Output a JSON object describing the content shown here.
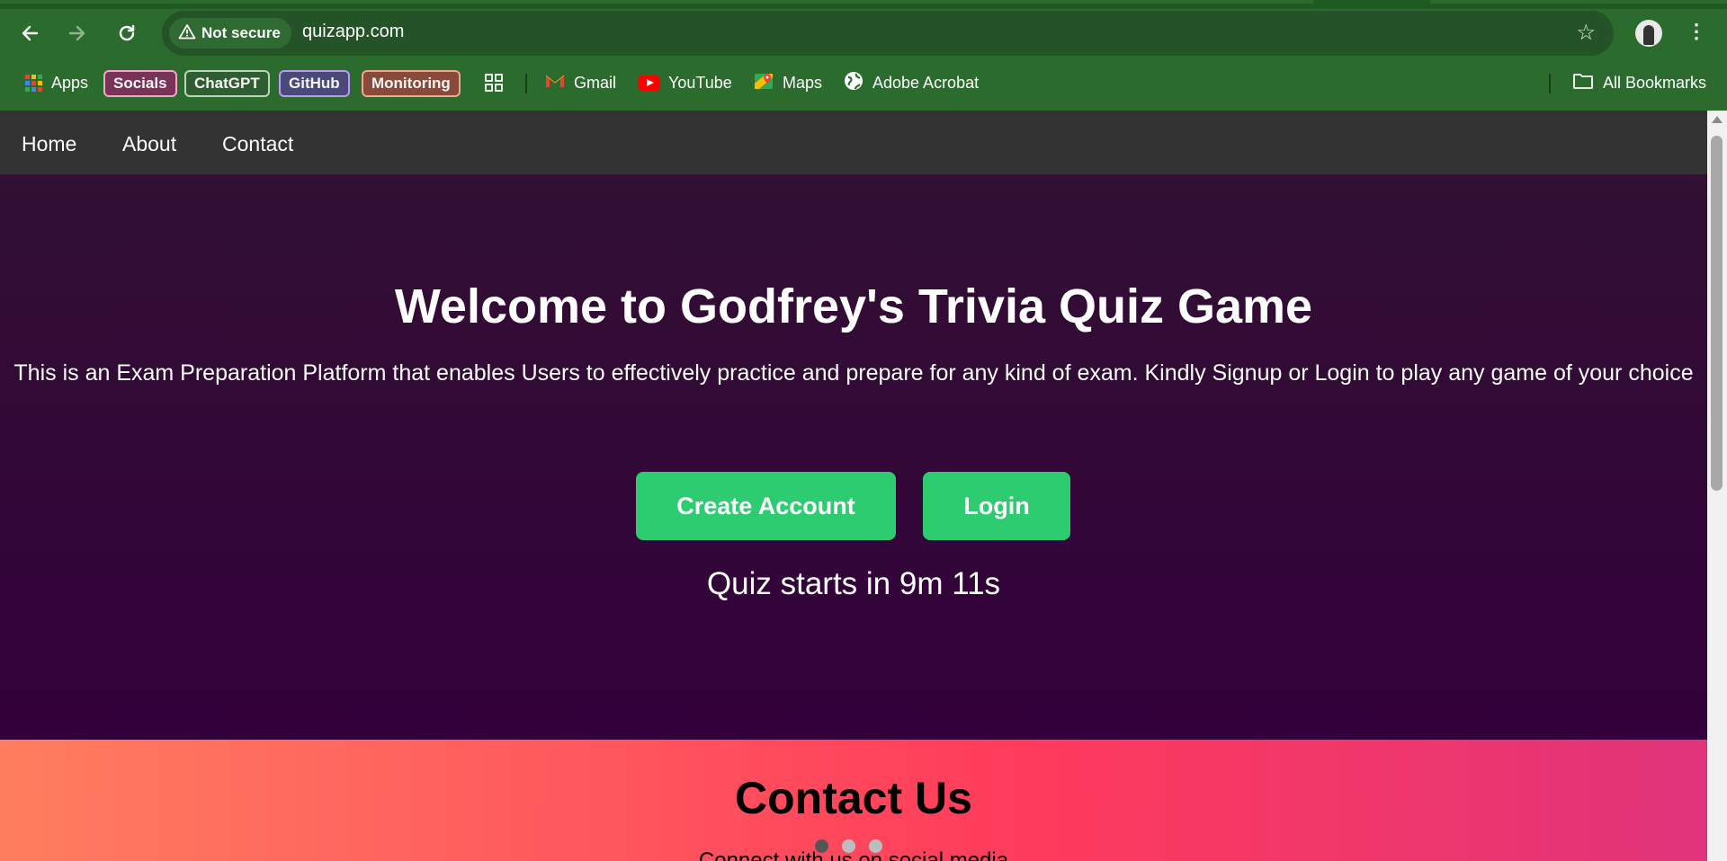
{
  "browser": {
    "security_label": "Not secure",
    "url": "quizapp.com",
    "bookmarks": {
      "apps": "Apps",
      "socials": "Socials",
      "chatgpt": "ChatGPT",
      "github": "GitHub",
      "monitoring": "Monitoring",
      "gmail": "Gmail",
      "youtube": "YouTube",
      "maps": "Maps",
      "adobe": "Adobe Acrobat",
      "all": "All Bookmarks"
    },
    "colors": {
      "frame": "#2b6b2e",
      "omnibox": "#245328"
    }
  },
  "nav": {
    "home": "Home",
    "about": "About",
    "contact": "Contact"
  },
  "hero": {
    "title": "Welcome to Godfrey's Trivia Quiz Game",
    "description": "This is an Exam Preparation Platform that enables Users to effectively practice and prepare for any kind of exam. Kindly Signup or Login to play any game of your choice",
    "create_account": "Create Account",
    "login": "Login",
    "countdown": "Quiz starts in 9m 11s",
    "button_color": "#2ecc71"
  },
  "contact": {
    "title": "Contact Us",
    "subtitle": "Connect with us on social media"
  },
  "carousel": {
    "count": 3,
    "active_index": 0
  }
}
